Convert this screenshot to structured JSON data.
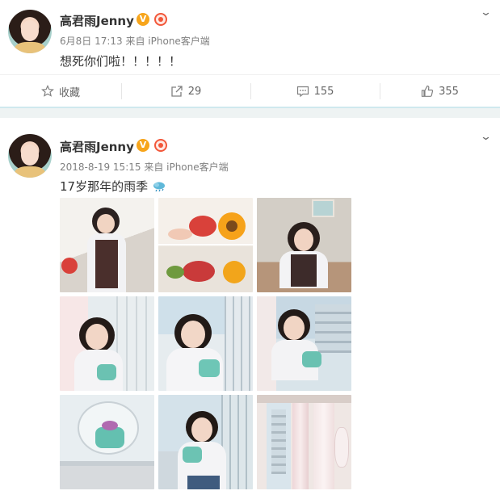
{
  "post1": {
    "author": "高君雨Jenny",
    "verified_badge": "V",
    "meta": "6月8日 17:13 来自 iPhone客户端",
    "text": "想死你们啦！！！！！",
    "actions": {
      "favorite_label": "收藏",
      "repost_count": "29",
      "comment_count": "155",
      "like_count": "355"
    }
  },
  "post2": {
    "author": "高君雨Jenny",
    "verified_badge": "V",
    "meta": "2018-8-19 15:15 来自 iPhone客户端",
    "text": "17岁那年的雨季",
    "emoji_icon": "rain-cloud-icon",
    "photos": [
      "girl-with-flowers-photo",
      "sunflower-bouquet-photo",
      "girl-at-table-photo",
      "girl-with-cake-window-photo",
      "girl-smiling-cake-photo",
      "girl-sitting-window-photo",
      "cake-closeup-photo",
      "girl-holding-cake-photo",
      "curtain-window-photo"
    ]
  },
  "colors": {
    "accent": "#f7a51b",
    "medal": "#f2573a",
    "meta_gray": "#808080",
    "band": "#eef3f3"
  },
  "icons": [
    "chevron-down-icon",
    "star-icon",
    "repost-icon",
    "comment-icon",
    "like-icon",
    "medal-icon",
    "verified-icon"
  ]
}
